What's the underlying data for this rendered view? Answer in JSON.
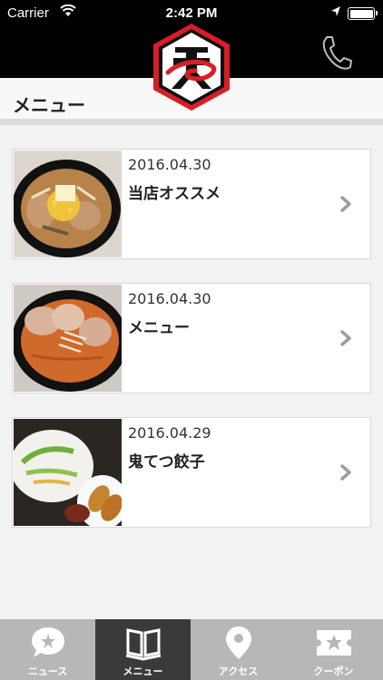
{
  "status_bar": {
    "carrier": "Carrier",
    "time": "2:42 PM"
  },
  "header": {
    "logo_icon": "oni-logo",
    "phone_icon": "phone-icon",
    "title": "メニュー"
  },
  "items": [
    {
      "date": "2016.04.30",
      "title": "当店オススメ",
      "thumb": "miso-ramen-photo"
    },
    {
      "date": "2016.04.30",
      "title": "メニュー",
      "thumb": "chashu-ramen-photo"
    },
    {
      "date": "2016.04.29",
      "title": "鬼てつ餃子",
      "thumb": "gyoza-photo"
    }
  ],
  "tabbar": {
    "tabs": [
      {
        "label": "ニュース",
        "icon": "speech-bubble-star-icon",
        "active": false
      },
      {
        "label": "メニュー",
        "icon": "open-book-icon",
        "active": true
      },
      {
        "label": "アクセス",
        "icon": "map-pin-icon",
        "active": false
      },
      {
        "label": "クーポン",
        "icon": "ticket-star-icon",
        "active": false
      }
    ]
  },
  "colors": {
    "header_bg": "#000000",
    "logo_red": "#d81e26",
    "tab_active": "#3a3a3a",
    "tab_bg": "#b7b7b7"
  }
}
